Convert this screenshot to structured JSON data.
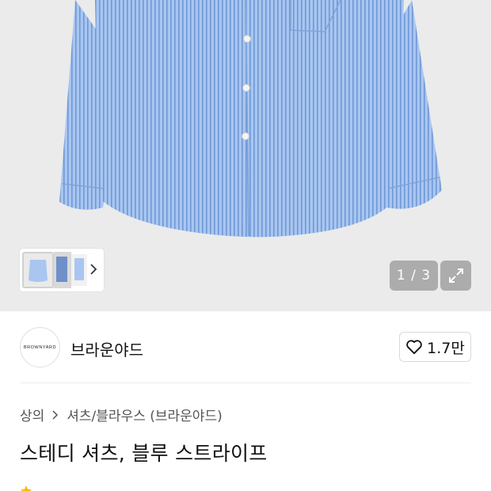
{
  "gallery": {
    "pager": "1 / 3",
    "expand_icon": "expand-icon",
    "thumbnail_next_icon": "chevron-right-icon"
  },
  "brand": {
    "logo_text": "BROWNYARD",
    "name": "브라운야드",
    "like_icon": "heart-outline-icon",
    "like_count": "1.7만"
  },
  "breadcrumb": {
    "items": [
      "상의",
      "셔츠/블라우스 (브라운야드)"
    ],
    "separator_icon": "chevron-right-icon"
  },
  "product": {
    "title": "스테디 셔츠, 블루 스트라이프"
  },
  "colors": {
    "shirt_blue": "#8fb3e6",
    "hero_bg": "#ebebeb",
    "star": "#f5b800"
  }
}
